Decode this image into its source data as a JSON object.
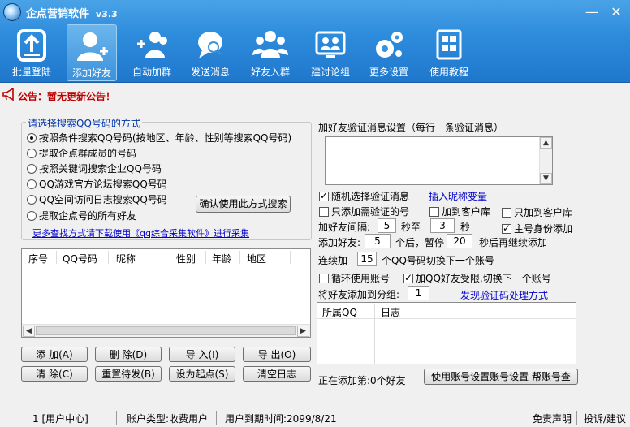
{
  "window": {
    "title": "企点营销软件",
    "version": "v3.3",
    "minimize": "—",
    "close": "✕"
  },
  "toolbar": [
    {
      "label": "批量登陆",
      "icon": "login-icon",
      "active": false
    },
    {
      "label": "添加好友",
      "icon": "add-friend-icon",
      "active": true
    },
    {
      "label": "自动加群",
      "icon": "add-group-icon",
      "active": false
    },
    {
      "label": "发送消息",
      "icon": "message-icon",
      "active": false
    },
    {
      "label": "好友入群",
      "icon": "friends-group-icon",
      "active": false
    },
    {
      "label": "建讨论组",
      "icon": "discussion-icon",
      "active": false
    },
    {
      "label": "更多设置",
      "icon": "settings-icon",
      "active": false
    },
    {
      "label": "使用教程",
      "icon": "tutorial-icon",
      "active": false
    }
  ],
  "notice": {
    "text": "公告：暂无更新公告！",
    "icon": "megaphone-icon"
  },
  "search": {
    "title": "请选择搜索QQ号码的方式",
    "options": [
      {
        "label": "按照条件搜索QQ号码(按地区、年龄、性别等搜索QQ号码)",
        "selected": true
      },
      {
        "label": "提取企点群成员的号码",
        "selected": false
      },
      {
        "label": "按照关键词搜索企业QQ号码",
        "selected": false
      },
      {
        "label": "QQ游戏官方论坛搜索QQ号码",
        "selected": false
      },
      {
        "label": "QQ空间访问日志搜索QQ号码",
        "selected": false
      },
      {
        "label": "提取企点号的所有好友",
        "selected": false
      }
    ],
    "confirm_button": "确认使用此方式搜索",
    "more_link": "更多查找方式请下载使用《qq综合采集软件》进行采集"
  },
  "left_table": {
    "columns": [
      "序号",
      "QQ号码",
      "昵称",
      "性别",
      "年龄",
      "地区"
    ],
    "rows": []
  },
  "buttons": {
    "add": "添 加(A)",
    "delete": "删 除(D)",
    "import": "导 入(I)",
    "export": "导 出(O)",
    "clear": "清 除(C)",
    "reset": "重置待发(B)",
    "set_start": "设为起点(S)",
    "clear_log": "清空日志"
  },
  "verify": {
    "title": "加好友验证消息设置（每行一条验证消息）",
    "message": "",
    "random_label": "随机选择验证消息",
    "random_checked": true,
    "insert_link": "插入昵称变量"
  },
  "options": {
    "only_verify": {
      "label": "只添加需验证的号",
      "checked": false
    },
    "add_to_customer": {
      "label": "加到客户库",
      "checked": false
    },
    "only_customer": {
      "label": "只加到客户库",
      "checked": false
    },
    "interval_label": "加好友间隔:",
    "interval_min": "5",
    "interval_to": "秒至",
    "interval_max": "3",
    "interval_unit": "秒",
    "main_identity": {
      "label": "主号身份添加",
      "checked": true
    },
    "pause_label": "添加好友:",
    "pause_count": "5",
    "pause_mid": "个后，暂停",
    "pause_seconds": "20",
    "pause_tail": "秒后再继续添加",
    "switch_label": "连续加",
    "switch_count": "15",
    "switch_tail": "个QQ号码切换下一个账号",
    "loop_accounts": {
      "label": "循环使用账号",
      "checked": false
    },
    "limit_switch": {
      "label": "加QQ好友受限,切换下一个账号",
      "checked": true
    },
    "group_label": "将好友添加到分组:",
    "group_value": "1",
    "captcha_link": "发现验证码处理方式"
  },
  "log_table": {
    "columns": [
      "所属QQ",
      "日志"
    ],
    "rows": []
  },
  "progress_text": "正在添加第:0个好友",
  "account_button": "使用账号设置账号设置 帮账号查",
  "status": {
    "user_center": "1 [用户中心]",
    "account_type": "账户类型:收费用户",
    "expire": "用户到期时间:2099/8/21",
    "disclaimer": "免责声明",
    "feedback": "投诉/建议"
  }
}
